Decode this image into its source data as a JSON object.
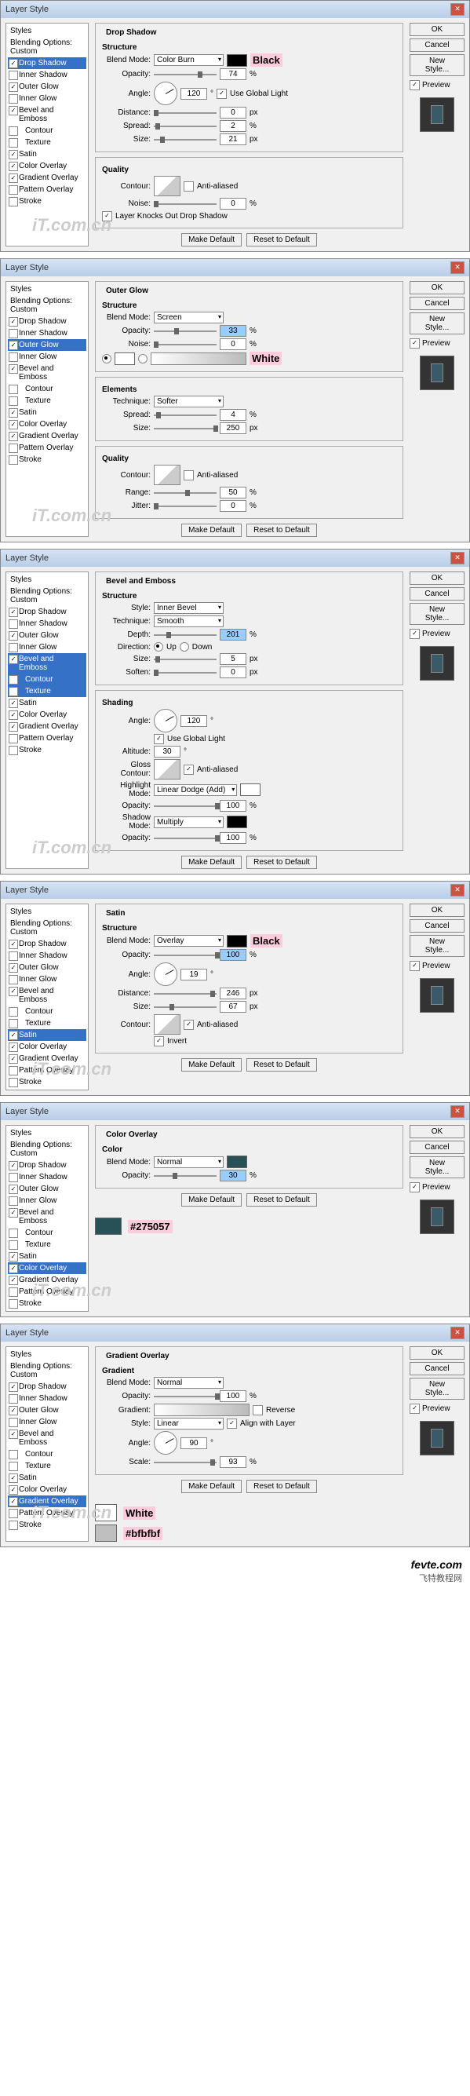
{
  "title": "Layer Style",
  "btn_ok": "OK",
  "btn_cancel": "Cancel",
  "btn_newstyle": "New Style...",
  "btn_make": "Make Default",
  "btn_reset": "Reset to Default",
  "preview": "Preview",
  "side_head": "Styles",
  "side_blend": "Blending Options: Custom",
  "items": [
    "Drop Shadow",
    "Inner Shadow",
    "Outer Glow",
    "Inner Glow",
    "Bevel and Emboss",
    "Contour",
    "Texture",
    "Satin",
    "Color Overlay",
    "Gradient Overlay",
    "Pattern Overlay",
    "Stroke"
  ],
  "lab": {
    "blendmode": "Blend Mode:",
    "opacity": "Opacity:",
    "angle": "Angle:",
    "distance": "Distance:",
    "spread": "Spread:",
    "size": "Size:",
    "noise": "Noise:",
    "contour": "Contour:",
    "range": "Range:",
    "jitter": "Jitter:",
    "technique": "Technique:",
    "style": "Style:",
    "depth": "Depth:",
    "direction": "Direction:",
    "soften": "Soften:",
    "altitude": "Altitude:",
    "gloss": "Gloss Contour:",
    "hlmode": "Highlight Mode:",
    "shmode": "Shadow Mode:",
    "gradient": "Gradient:",
    "scale": "Scale:",
    "up": "Up",
    "down": "Down",
    "invert": "Invert",
    "reverse": "Reverse",
    "align": "Align with Layer"
  },
  "grp": {
    "structure": "Structure",
    "quality": "Quality",
    "elements": "Elements",
    "shading": "Shading",
    "gradient": "Gradient"
  },
  "antialiased": "Anti-aliased",
  "usegl": "Use Global Light",
  "knocks": "Layer Knocks Out Drop Shadow",
  "d1": {
    "name": "Drop Shadow",
    "mode": "Color Burn",
    "opacity": "74",
    "angle": "120",
    "distance": "0",
    "spread": "2",
    "size": "21",
    "noise": "0",
    "annot": "Black"
  },
  "d2": {
    "name": "Outer Glow",
    "mode": "Screen",
    "opacity": "33",
    "noise": "0",
    "tech": "Softer",
    "spread": "4",
    "size": "250",
    "range": "50",
    "jitter": "0",
    "annot": "White"
  },
  "d3": {
    "name": "Bevel and Emboss",
    "style": "Inner Bevel",
    "tech": "Smooth",
    "depth": "201",
    "size": "5",
    "soften": "0",
    "angle": "120",
    "altitude": "30",
    "hlmode": "Linear Dodge (Add)",
    "hlop": "100",
    "shmode": "Multiply",
    "shop": "100"
  },
  "d4": {
    "name": "Satin",
    "mode": "Overlay",
    "opacity": "100",
    "angle": "19",
    "distance": "246",
    "size": "67",
    "annot": "Black"
  },
  "d5": {
    "name": "Color Overlay",
    "mode": "Normal",
    "opacity": "30",
    "annot": "#275057"
  },
  "d6": {
    "name": "Gradient Overlay",
    "mode": "Normal",
    "opacity": "100",
    "style": "Linear",
    "angle": "90",
    "scale": "93",
    "a1": "White",
    "a2": "#bfbfbf"
  },
  "footer1": "fevte.com",
  "footer2": "飞特教程网"
}
